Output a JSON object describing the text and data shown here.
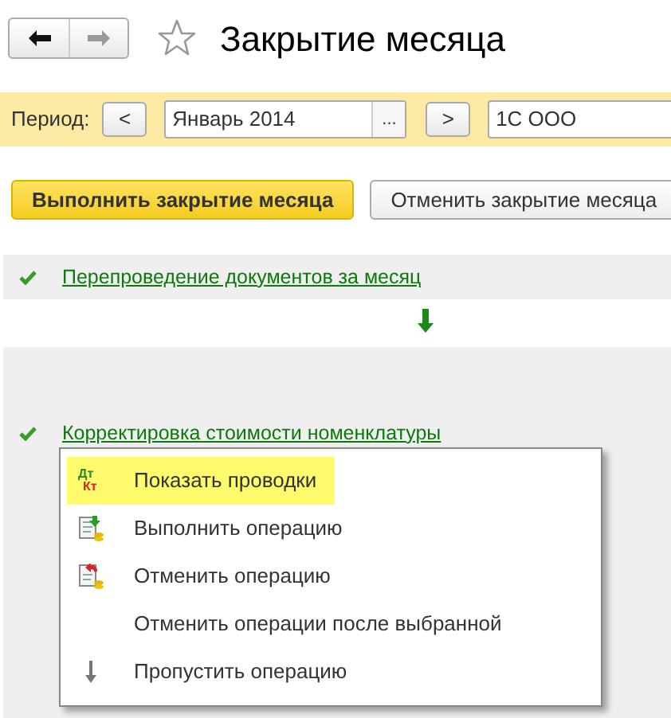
{
  "window": {
    "title": "Закрытие месяца",
    "favorite": false
  },
  "period": {
    "label": "Период:",
    "prev": "<",
    "value": "Январь 2014",
    "select": "...",
    "next": ">",
    "organization": "1С ООО"
  },
  "buttons": [
    {
      "label": "Выполнить закрытие месяца",
      "kind": "primary"
    },
    {
      "label": "Отменить закрытие месяца",
      "kind": "secondary"
    }
  ],
  "steps": [
    {
      "label": "Перепроведение документов за месяц",
      "done": true
    },
    {
      "label": "Корректировка стоимости номенклатуры",
      "done": true
    }
  ],
  "context_menu": [
    {
      "label": "Показать проводки",
      "kind": "postings",
      "icon_top": "Дт",
      "icon_bottom": "Кт",
      "selected": true
    },
    {
      "label": "Выполнить операцию",
      "kind": "run",
      "selected": false
    },
    {
      "label": "Отменить операцию",
      "kind": "undo",
      "selected": false
    },
    {
      "label": "Отменить операции после выбранной",
      "kind": "none",
      "selected": false
    },
    {
      "label": "Пропустить операцию",
      "kind": "skip",
      "selected": false
    }
  ]
}
